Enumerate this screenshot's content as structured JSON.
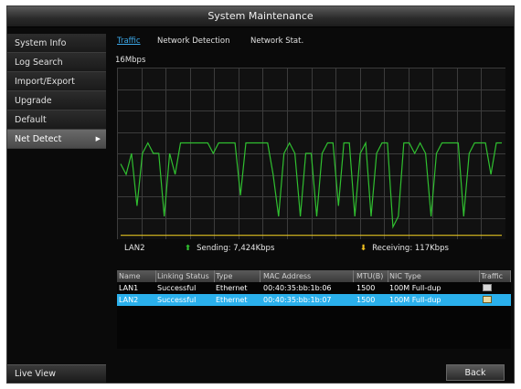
{
  "window": {
    "title": "System Maintenance"
  },
  "sidebar": {
    "items": [
      {
        "label": "System Info",
        "active": false
      },
      {
        "label": "Log Search",
        "active": false
      },
      {
        "label": "Import/Export",
        "active": false
      },
      {
        "label": "Upgrade",
        "active": false
      },
      {
        "label": "Default",
        "active": false
      },
      {
        "label": "Net Detect",
        "active": true
      }
    ],
    "live_view": "Live View"
  },
  "tabs": [
    {
      "label": "Traffic",
      "active": true
    },
    {
      "label": "Network Detection",
      "active": false
    },
    {
      "label": "Network Stat.",
      "active": false
    }
  ],
  "traffic": {
    "scale_label": "16Mbps",
    "interface": "LAN2",
    "sending": "Sending: 7,424Kbps",
    "receiving": "Receiving: 117Kbps"
  },
  "chart_data": {
    "type": "line",
    "ylim": [
      0,
      16
    ],
    "grid": true,
    "series": [
      {
        "color": "#30c030",
        "values": [
          7,
          6,
          8,
          3,
          8,
          9,
          8,
          8,
          2,
          8,
          6,
          9,
          9,
          9,
          9,
          9,
          9,
          8,
          9,
          9,
          9,
          9,
          4,
          9,
          9,
          9,
          9,
          9,
          6,
          2,
          8,
          9,
          8,
          2,
          8,
          8,
          2,
          8,
          9,
          9,
          3,
          9,
          9,
          2,
          8,
          9,
          2,
          8,
          9,
          9,
          1,
          2,
          9,
          9,
          8,
          9,
          8,
          2,
          8,
          9,
          9,
          9,
          9,
          2,
          8,
          9,
          9,
          9,
          6,
          9,
          9
        ]
      },
      {
        "color": "#e0c020",
        "values": [
          0.2,
          0.2,
          0.2,
          0.2,
          0.2,
          0.2,
          0.2,
          0.2,
          0.2,
          0.2,
          0.2,
          0.2,
          0.2,
          0.2,
          0.2,
          0.2,
          0.2,
          0.2,
          0.2,
          0.2,
          0.2,
          0.2,
          0.2,
          0.2,
          0.2,
          0.2,
          0.2,
          0.2,
          0.2,
          0.2,
          0.2,
          0.2,
          0.2,
          0.2,
          0.2,
          0.2,
          0.2,
          0.2,
          0.2,
          0.2,
          0.2,
          0.2,
          0.2,
          0.2,
          0.2,
          0.2,
          0.2,
          0.2,
          0.2,
          0.2,
          0.2,
          0.2,
          0.2,
          0.2,
          0.2,
          0.2,
          0.2,
          0.2,
          0.2,
          0.2,
          0.2,
          0.2,
          0.2,
          0.2,
          0.2,
          0.2,
          0.2,
          0.2,
          0.2,
          0.2,
          0.2
        ]
      }
    ]
  },
  "table": {
    "headers": [
      "Name",
      "Linking Status",
      "Type",
      "MAC Address",
      "MTU(B)",
      "NIC Type",
      "Traffic"
    ],
    "rows": [
      {
        "name": "LAN1",
        "status": "Successful",
        "type": "Ethernet",
        "mac": "00:40:35:bb:1b:06",
        "mtu": "1500",
        "nic": "100M Full-dup",
        "selected": false
      },
      {
        "name": "LAN2",
        "status": "Successful",
        "type": "Ethernet",
        "mac": "00:40:35:bb:1b:07",
        "mtu": "1500",
        "nic": "100M Full-dup",
        "selected": true
      }
    ]
  },
  "buttons": {
    "back": "Back"
  },
  "icons": {
    "traffic": "traffic-chart-icon",
    "up": "arrow-up-icon",
    "down": "arrow-down-icon",
    "caret": "caret-right-icon"
  }
}
